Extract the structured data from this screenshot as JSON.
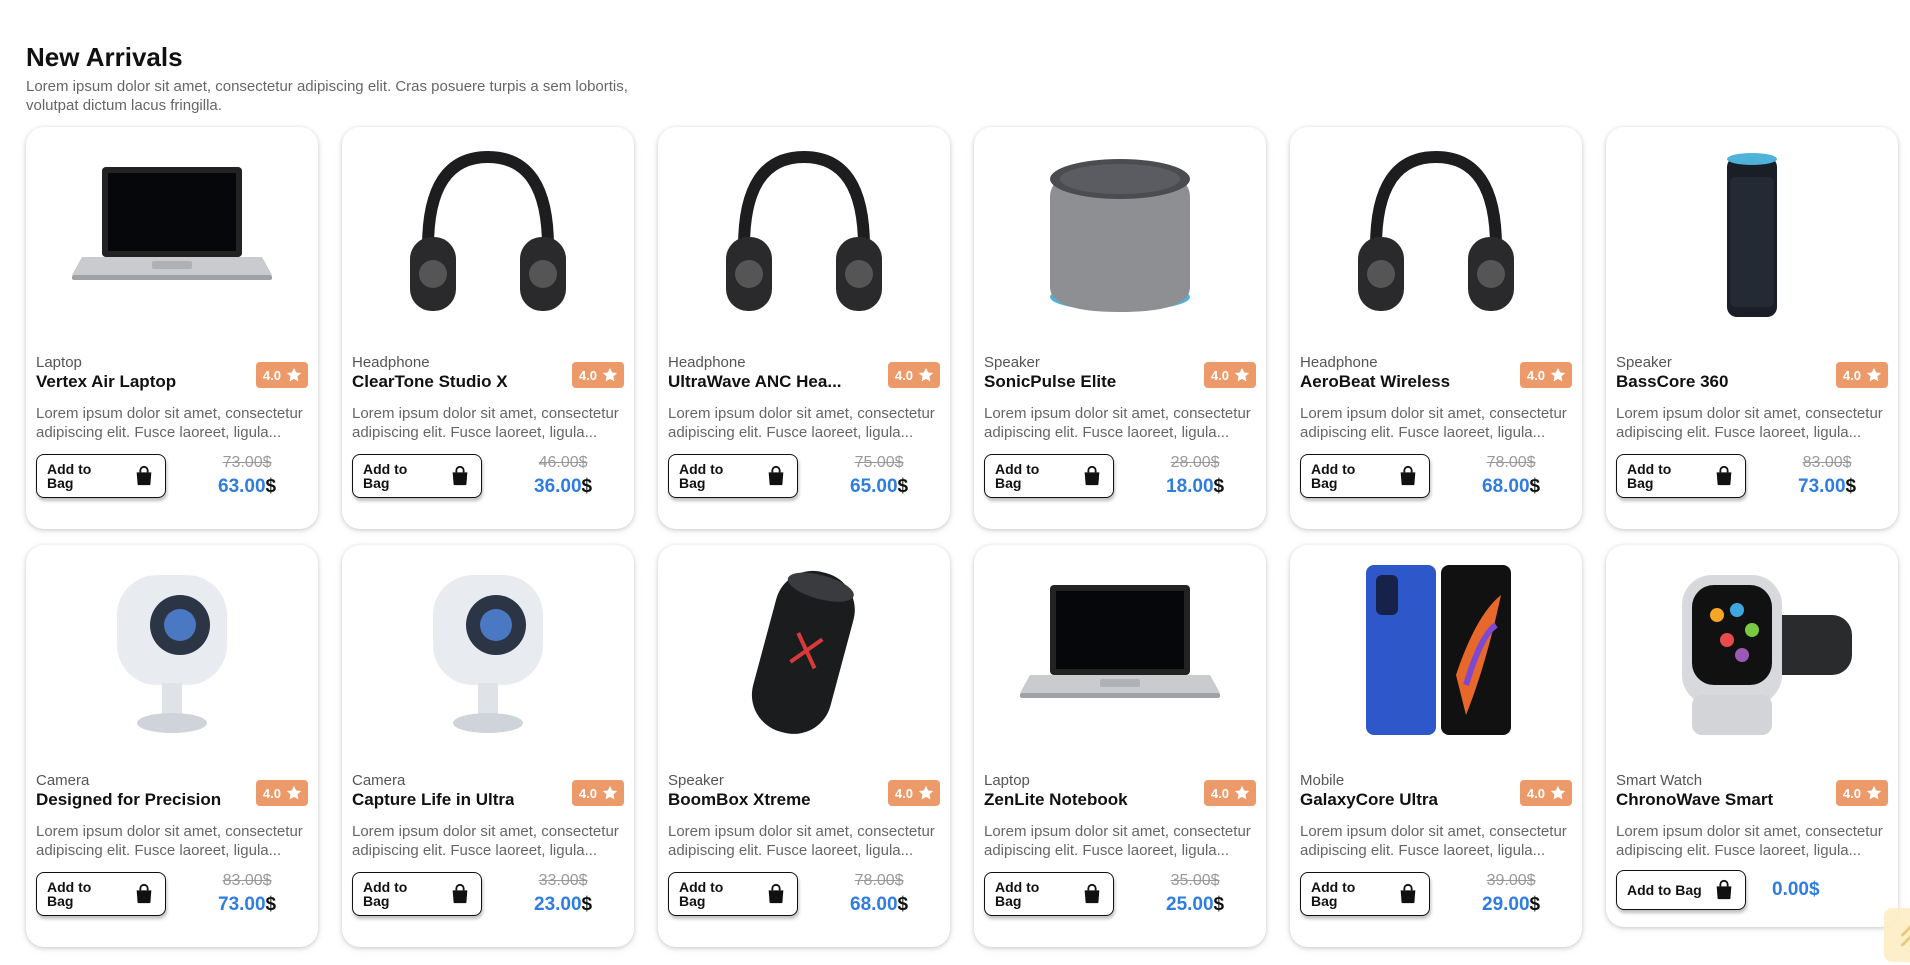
{
  "section": {
    "title": "New Arrivals",
    "subtitle": "Lorem ipsum dolor sit amet, consectetur adipiscing elit. Cras posuere turpis a sem lobortis, volutpat dictum lacus fringilla."
  },
  "colors": {
    "accent": "#2f7de1",
    "rating_bg": "#ec9a6a",
    "scroll_top_bg": "#fdeec4"
  },
  "products": [
    {
      "category": "Laptop",
      "title": "Vertex Air Laptop",
      "rating": "4.0",
      "desc": "Lorem ipsum dolor sit amet, consectetur adipiscing elit. Fusce laoreet, ligula...",
      "button": "Add to Bag",
      "old_price": "73.00$",
      "price": "63.00",
      "currency": "$",
      "icon": "laptop-icon"
    },
    {
      "category": "Headphone",
      "title": "ClearTone Studio X",
      "rating": "4.0",
      "desc": "Lorem ipsum dolor sit amet, consectetur adipiscing elit. Fusce laoreet, ligula...",
      "button": "Add to Bag",
      "old_price": "46.00$",
      "price": "36.00",
      "currency": "$",
      "icon": "headphone-icon"
    },
    {
      "category": "Headphone",
      "title": "UltraWave ANC Hea...",
      "rating": "4.0",
      "desc": "Lorem ipsum dolor sit amet, consectetur adipiscing elit. Fusce laoreet, ligula...",
      "button": "Add to Bag",
      "old_price": "75.00$",
      "price": "65.00",
      "currency": "$",
      "icon": "headphone-icon"
    },
    {
      "category": "Speaker",
      "title": "SonicPulse Elite",
      "rating": "4.0",
      "desc": "Lorem ipsum dolor sit amet, consectetur adipiscing elit. Fusce laoreet, ligula...",
      "button": "Add to Bag",
      "old_price": "28.00$",
      "price": "18.00",
      "currency": "$",
      "icon": "smart-speaker-icon"
    },
    {
      "category": "Headphone",
      "title": "AeroBeat Wireless",
      "rating": "4.0",
      "desc": "Lorem ipsum dolor sit amet, consectetur adipiscing elit. Fusce laoreet, ligula...",
      "button": "Add to Bag",
      "old_price": "78.00$",
      "price": "68.00",
      "currency": "$",
      "icon": "headphone-icon"
    },
    {
      "category": "Speaker",
      "title": "BassCore 360",
      "rating": "4.0",
      "desc": "Lorem ipsum dolor sit amet, consectetur adipiscing elit. Fusce laoreet, ligula...",
      "button": "Add to Bag",
      "old_price": "83.00$",
      "price": "73.00",
      "currency": "$",
      "icon": "tower-speaker-icon"
    },
    {
      "category": "Camera",
      "title": "Designed for Precision",
      "rating": "4.0",
      "desc": "Lorem ipsum dolor sit amet, consectetur adipiscing elit. Fusce laoreet, ligula...",
      "button": "Add to Bag",
      "old_price": "83.00$",
      "price": "73.00",
      "currency": "$",
      "icon": "camera-icon"
    },
    {
      "category": "Camera",
      "title": "Capture Life in Ultra",
      "rating": "4.0",
      "desc": "Lorem ipsum dolor sit amet, consectetur adipiscing elit. Fusce laoreet, ligula...",
      "button": "Add to Bag",
      "old_price": "33.00$",
      "price": "23.00",
      "currency": "$",
      "icon": "camera-icon"
    },
    {
      "category": "Speaker",
      "title": "BoomBox Xtreme",
      "rating": "4.0",
      "desc": "Lorem ipsum dolor sit amet, consectetur adipiscing elit. Fusce laoreet, ligula...",
      "button": "Add to Bag",
      "old_price": "78.00$",
      "price": "68.00",
      "currency": "$",
      "icon": "portable-speaker-icon"
    },
    {
      "category": "Laptop",
      "title": "ZenLite Notebook",
      "rating": "4.0",
      "desc": "Lorem ipsum dolor sit amet, consectetur adipiscing elit. Fusce laoreet, ligula...",
      "button": "Add to Bag",
      "old_price": "35.00$",
      "price": "25.00",
      "currency": "$",
      "icon": "laptop-icon"
    },
    {
      "category": "Mobile",
      "title": "GalaxyCore Ultra",
      "rating": "4.0",
      "desc": "Lorem ipsum dolor sit amet, consectetur adipiscing elit. Fusce laoreet, ligula...",
      "button": "Add to Bag",
      "old_price": "39.00$",
      "price": "29.00",
      "currency": "$",
      "icon": "phone-icon"
    },
    {
      "category": "Smart Watch",
      "title": "ChronoWave Smart",
      "rating": "4.0",
      "desc": "Lorem ipsum dolor sit amet, consectetur adipiscing elit. Fusce laoreet, ligula...",
      "button": "Add to Bag",
      "old_price": "",
      "price": "0.00$",
      "currency": "",
      "icon": "smartwatch-icon"
    }
  ]
}
